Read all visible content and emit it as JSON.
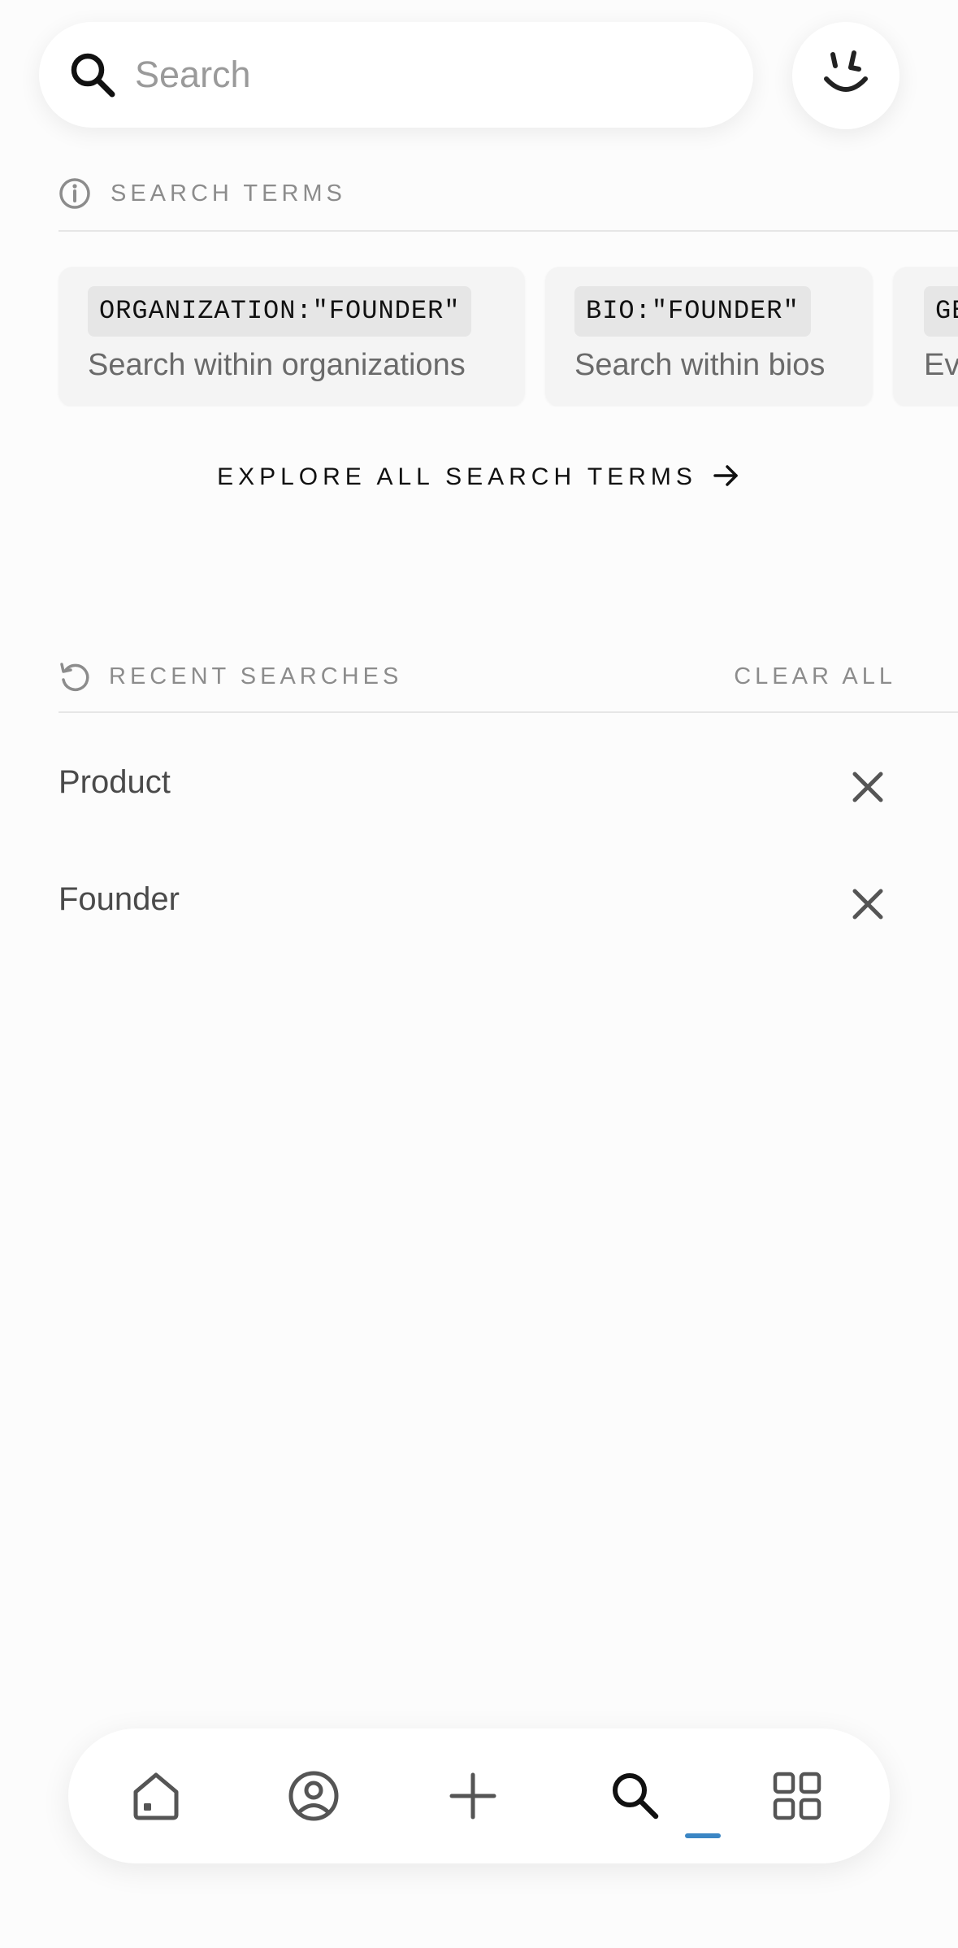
{
  "search": {
    "placeholder": "Search",
    "value": ""
  },
  "avatar": {
    "icon": "smiley-face-icon"
  },
  "search_terms": {
    "title": "SEARCH TERMS",
    "icon": "info-icon",
    "cards": [
      {
        "term": "ORGANIZATION:\"FOUNDER\"",
        "description": "Search within organizations"
      },
      {
        "term": "BIO:\"FOUNDER\"",
        "description": "Search within bios"
      },
      {
        "term": "GE",
        "description": "Ev"
      }
    ],
    "explore_label": "EXPLORE ALL SEARCH TERMS"
  },
  "recent_searches": {
    "title": "RECENT SEARCHES",
    "icon": "history-icon",
    "clear_label": "CLEAR ALL",
    "items": [
      {
        "label": "Product"
      },
      {
        "label": "Founder"
      }
    ]
  },
  "bottom_nav": {
    "items": [
      "home-icon",
      "profile-icon",
      "add-icon",
      "search-icon",
      "grid-icon"
    ],
    "active": "search-icon"
  },
  "colors": {
    "background": "#fcfcfc",
    "text_muted": "#8c8c8c",
    "accent": "#3b86c4",
    "chip_bg": "#e6e6e6",
    "card_bg": "#f4f4f4"
  }
}
